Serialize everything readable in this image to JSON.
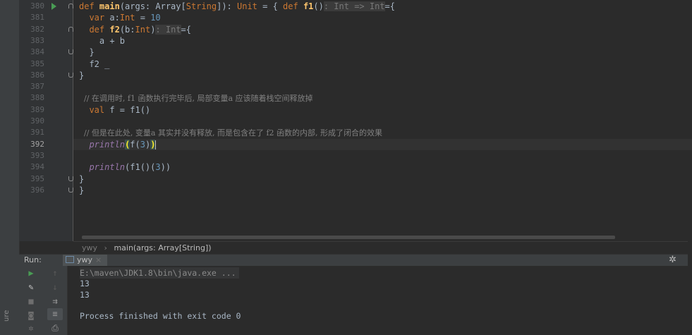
{
  "editor": {
    "lines": [
      {
        "num": "380",
        "run": true,
        "fold": "start",
        "tokens": [
          {
            "t": "def ",
            "c": "kw"
          },
          {
            "t": "main",
            "c": "fn"
          },
          {
            "t": "(args: Array[",
            "c": "pl"
          },
          {
            "t": "String",
            "c": "kw"
          },
          {
            "t": "]): ",
            "c": "pl"
          },
          {
            "t": "Unit",
            "c": "kw"
          },
          {
            "t": " = { ",
            "c": "pl"
          },
          {
            "t": "def ",
            "c": "kw"
          },
          {
            "t": "f1",
            "c": "fn"
          },
          {
            "t": "()",
            "c": "pl"
          },
          {
            "t": ": Int => Int",
            "c": "hint"
          },
          {
            "t": "={",
            "c": "pl"
          }
        ]
      },
      {
        "num": "381",
        "tokens": [
          {
            "t": "  var ",
            "c": "kw"
          },
          {
            "t": "a:",
            "c": "pl"
          },
          {
            "t": "Int",
            "c": "kw"
          },
          {
            "t": " = ",
            "c": "pl"
          },
          {
            "t": "10",
            "c": "num"
          }
        ]
      },
      {
        "num": "382",
        "fold": "start",
        "tokens": [
          {
            "t": "  def ",
            "c": "kw"
          },
          {
            "t": "f2",
            "c": "fn"
          },
          {
            "t": "(b:",
            "c": "pl"
          },
          {
            "t": "Int",
            "c": "kw"
          },
          {
            "t": ")",
            "c": "pl"
          },
          {
            "t": ": Int",
            "c": "hint"
          },
          {
            "t": "={",
            "c": "pl"
          }
        ]
      },
      {
        "num": "383",
        "tokens": [
          {
            "t": "    a + b",
            "c": "pl"
          }
        ]
      },
      {
        "num": "384",
        "fold": "end",
        "tokens": [
          {
            "t": "  }",
            "c": "pl"
          }
        ]
      },
      {
        "num": "385",
        "tokens": [
          {
            "t": "  f2 _",
            "c": "pl"
          }
        ]
      },
      {
        "num": "386",
        "fold": "end",
        "tokens": [
          {
            "t": "}",
            "c": "pl"
          }
        ]
      },
      {
        "num": "387",
        "tokens": []
      },
      {
        "num": "388",
        "tokens": [
          {
            "t": "  // 在调用时, f1 函数执行完毕后, 局部变量a 应该随着栈空间释放掉",
            "c": "cmt"
          }
        ]
      },
      {
        "num": "389",
        "tokens": [
          {
            "t": "  val ",
            "c": "kw"
          },
          {
            "t": "f = f1()",
            "c": "pl"
          }
        ]
      },
      {
        "num": "390",
        "tokens": []
      },
      {
        "num": "391",
        "tokens": [
          {
            "t": "  // 但是在此处, 变量a 其实并没有释放, 而是包含在了 f2 函数的内部, 形成了闭合的效果",
            "c": "cmt"
          }
        ]
      },
      {
        "num": "392",
        "current": true,
        "tokens": [
          {
            "t": "  ",
            "c": "pl"
          },
          {
            "t": "println",
            "c": "call"
          },
          {
            "t": "(",
            "c": "bm"
          },
          {
            "t": "f(",
            "c": "pl"
          },
          {
            "t": "3",
            "c": "num"
          },
          {
            "t": ")",
            "c": "pl"
          },
          {
            "t": ")",
            "c": "bm"
          },
          {
            "t": "",
            "c": "caret"
          }
        ]
      },
      {
        "num": "393",
        "tokens": []
      },
      {
        "num": "394",
        "tokens": [
          {
            "t": "  ",
            "c": "pl"
          },
          {
            "t": "println",
            "c": "call"
          },
          {
            "t": "(f1()(",
            "c": "pl"
          },
          {
            "t": "3",
            "c": "num"
          },
          {
            "t": "))",
            "c": "pl"
          }
        ]
      },
      {
        "num": "395",
        "fold": "end",
        "tokens": [
          {
            "t": "}",
            "c": "pl"
          }
        ]
      },
      {
        "num": "396",
        "fold": "end",
        "tokens": [
          {
            "t": "}",
            "c": "pl"
          }
        ]
      }
    ]
  },
  "breadcrumb": {
    "root": "ywy",
    "separator": "›",
    "current": "main(args: Array[String])"
  },
  "run_panel": {
    "label": "Run:",
    "tab": "ywy",
    "tab_close": "×",
    "output": [
      {
        "text": "E:\\maven\\JDK1.8\\bin\\java.exe ...",
        "kind": "cmd"
      },
      {
        "text": "13",
        "kind": "out"
      },
      {
        "text": "13",
        "kind": "out"
      },
      {
        "text": "",
        "kind": "out"
      },
      {
        "text": "Process finished with exit code 0",
        "kind": "out"
      }
    ]
  },
  "left_stripe": {
    "label": "ure"
  },
  "colors": {
    "background": "#2b2b2b",
    "keyword": "#cc7832",
    "function": "#ffc66d",
    "number": "#6897bb"
  }
}
